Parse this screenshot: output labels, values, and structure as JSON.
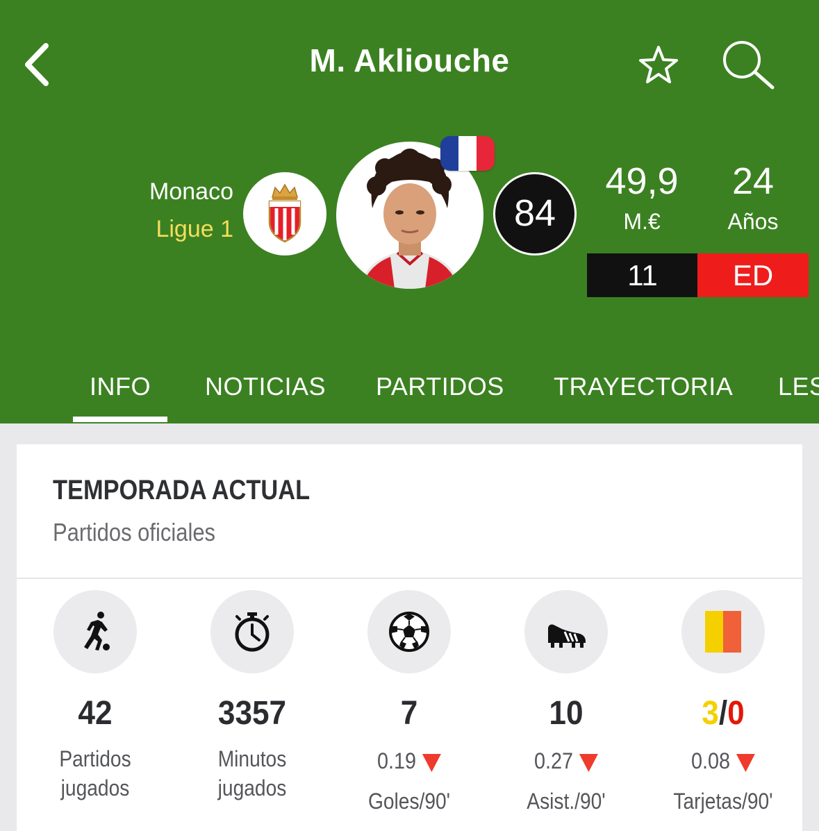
{
  "header": {
    "title": "M. Akliouche",
    "club": "Monaco",
    "league": "Ligue 1",
    "rating": "84",
    "market_value": "49,9",
    "market_value_unit": "M.€",
    "age": "24",
    "age_unit": "Años",
    "jersey_number": "11",
    "position": "ED",
    "flag_colors": [
      "#1f3f9b",
      "#ffffff",
      "#e8263a"
    ],
    "badge_text": "AS MONACO"
  },
  "tabs": [
    "INFO",
    "NOTICIAS",
    "PARTIDOS",
    "TRAYECTORIA",
    "LES"
  ],
  "active_tab": "INFO",
  "season": {
    "title": "TEMPORADA ACTUAL",
    "subtitle": "Partidos oficiales"
  },
  "stats": [
    {
      "icon": "player-dribbling-icon",
      "value": "42",
      "label_line1": "Partidos",
      "label_line2": "jugados"
    },
    {
      "icon": "stopwatch-icon",
      "value": "3357",
      "label_line1": "Minutos jugados"
    },
    {
      "icon": "soccer-ball-icon",
      "value": "7",
      "rate": "0.19",
      "label": "Goles/90'"
    },
    {
      "icon": "football-boot-icon",
      "value": "10",
      "rate": "0.27",
      "label": "Asist./90'"
    },
    {
      "icon": "cards-icon",
      "yellow": "3",
      "separator": "/",
      "red": "0",
      "rate": "0.08",
      "label": "Tarjetas/90'"
    }
  ],
  "colors": {
    "header_green": "#3b8121",
    "league_yellow": "#f5de5c",
    "position_red": "#ef1c1c",
    "trend_down": "#ef3b2c",
    "yellow_card": "#f5d000",
    "red_card": "#e3170a"
  }
}
